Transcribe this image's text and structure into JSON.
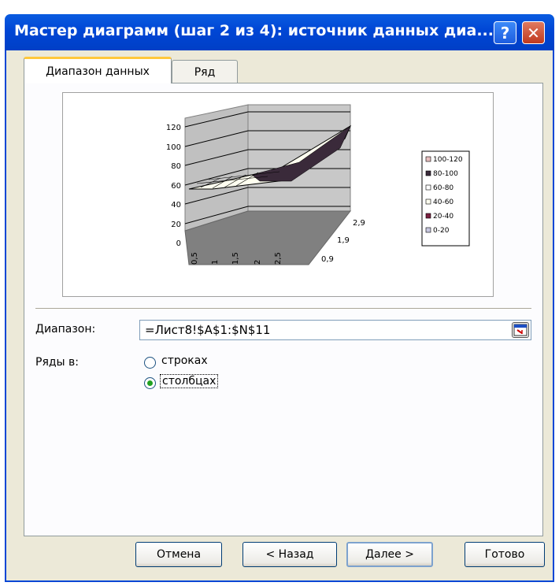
{
  "window": {
    "title": "Мастер диаграмм (шаг 2 из 4): источник данных диа...",
    "help_label": "?",
    "close_label": "✕"
  },
  "tabs": [
    {
      "label": "Диапазон данных",
      "active": true
    },
    {
      "label": "Ряд",
      "active": false
    }
  ],
  "chart_preview": {
    "type": "surface",
    "z_ticks": [
      "120",
      "100",
      "80",
      "60",
      "40",
      "20",
      "0"
    ],
    "x_ticks": [
      "0,5",
      "1",
      "1,5",
      "2",
      "2,5"
    ],
    "y_ticks": [
      "2,9",
      "1,9",
      "0,9"
    ],
    "legend": [
      {
        "label": "100-120",
        "color": "#e8c0c0"
      },
      {
        "label": "80-100",
        "color": "#3a2a3a"
      },
      {
        "label": "60-80",
        "color": "#ffffff"
      },
      {
        "label": "40-60",
        "color": "#fffff0"
      },
      {
        "label": "20-40",
        "color": "#7a2040"
      },
      {
        "label": "0-20",
        "color": "#c8c8e0"
      }
    ]
  },
  "range": {
    "label": "Диапазон:",
    "value": "=Лист8!$A$1:$N$11"
  },
  "series_in": {
    "label": "Ряды в:",
    "options": [
      {
        "label": "строках",
        "selected": false
      },
      {
        "label": "столбцах",
        "selected": true
      }
    ]
  },
  "buttons": {
    "cancel": "Отмена",
    "back": "< Назад",
    "next": "Далее >",
    "finish": "Готово"
  }
}
